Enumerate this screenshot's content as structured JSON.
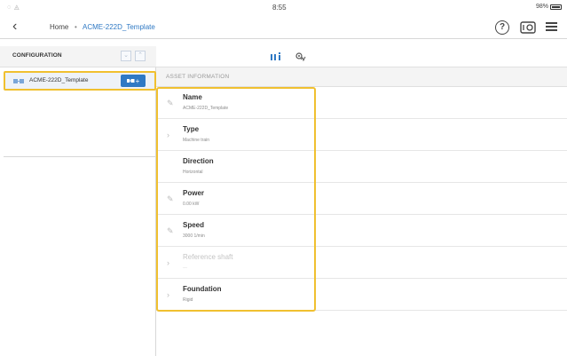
{
  "status_bar": {
    "time": "8:55",
    "battery": "98%"
  },
  "header": {
    "breadcrumb": {
      "home": "Home",
      "separator": "•",
      "asset": "ACME-222D_Template"
    },
    "help_icon": "question-circle",
    "device_icon": "device-sensor",
    "menu_icon": "hamburger"
  },
  "config": {
    "title": "CONFIGURATION",
    "tree_item_label": "ACME-222D_Template",
    "add_button_label": "+"
  },
  "tabs": [
    {
      "name": "asset-info",
      "icon": "info-bars",
      "active": true
    },
    {
      "name": "settings",
      "icon": "gear-pulse",
      "active": false
    }
  ],
  "asset_information": {
    "title": "ASSET INFORMATION",
    "rows": [
      {
        "label": "Name",
        "value": "ACME-222D_Template",
        "icon": "pencil-icon",
        "disabled": false
      },
      {
        "label": "Type",
        "value": "Machine train",
        "icon": "chevron-right-icon",
        "disabled": false
      },
      {
        "label": "Direction",
        "value": "Horizontal",
        "icon": "",
        "disabled": false
      },
      {
        "label": "Power",
        "value": "0.00 kW",
        "icon": "pencil-icon",
        "disabled": false
      },
      {
        "label": "Speed",
        "value": "3000 1/min",
        "icon": "pencil-icon",
        "disabled": false
      },
      {
        "label": "Reference shaft",
        "value": "---",
        "icon": "chevron-right-icon",
        "disabled": true
      },
      {
        "label": "Foundation",
        "value": "Rigid",
        "icon": "chevron-right-icon",
        "disabled": false
      }
    ]
  },
  "colors": {
    "accent": "#2f79c4",
    "highlight": "#f0c030"
  }
}
